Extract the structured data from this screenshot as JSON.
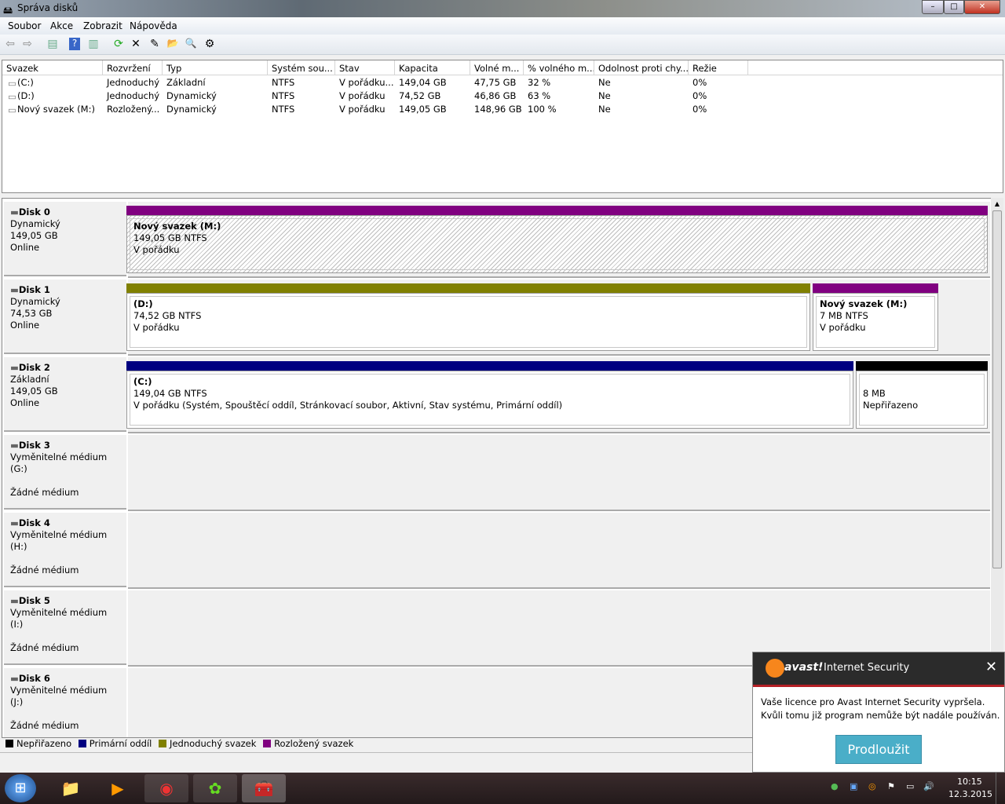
{
  "window": {
    "title": "Správa disků",
    "minimize": "–",
    "maximize": "□",
    "close": "✕"
  },
  "menu": [
    "Soubor",
    "Akce",
    "Zobrazit",
    "Nápověda"
  ],
  "toolbar": [
    {
      "icon": "back-icon",
      "glyph": "⇦"
    },
    {
      "icon": "forward-icon",
      "glyph": "⇨"
    },
    {
      "icon": "show-hide-console-tree-icon",
      "glyph": "▤"
    },
    {
      "icon": "help-icon",
      "glyph": "?"
    },
    {
      "icon": "show-action-pane-icon",
      "glyph": "▥"
    },
    {
      "icon": "refresh-icon",
      "glyph": "⟳"
    },
    {
      "icon": "delete-icon",
      "glyph": "✕"
    },
    {
      "icon": "properties-icon",
      "glyph": "✎"
    },
    {
      "icon": "open-folder-icon",
      "glyph": "📂"
    },
    {
      "icon": "explore-icon",
      "glyph": "🔍"
    },
    {
      "icon": "settings-icon",
      "glyph": "⚙"
    }
  ],
  "volumes": {
    "columns": [
      "Svazek",
      "Rozvržení",
      "Typ",
      "Systém sou...",
      "Stav",
      "Kapacita",
      "Volné m...",
      "% volného m...",
      "Odolnost proti chy...",
      "Režie"
    ],
    "rows": [
      [
        "(C:)",
        "Jednoduchý",
        "Základní",
        "NTFS",
        "V pořádku...",
        "149,04 GB",
        "47,75 GB",
        "32 %",
        "Ne",
        "0%"
      ],
      [
        "(D:)",
        "Jednoduchý",
        "Dynamický",
        "NTFS",
        "V pořádku",
        "74,52 GB",
        "46,86 GB",
        "63 %",
        "Ne",
        "0%"
      ],
      [
        "Nový svazek (M:)",
        "Rozložený...",
        "Dynamický",
        "NTFS",
        "V pořádku",
        "149,05 GB",
        "148,96 GB",
        "100 %",
        "Ne",
        "0%"
      ]
    ]
  },
  "disks": [
    {
      "name": "Disk 0",
      "type": "Dynamický",
      "size": "149,05 GB",
      "status": "Online"
    },
    {
      "name": "Disk 1",
      "type": "Dynamický",
      "size": "74,53 GB",
      "status": "Online"
    },
    {
      "name": "Disk 2",
      "type": "Základní",
      "size": "149,05 GB",
      "status": "Online"
    },
    {
      "name": "Disk 3",
      "type": "Vyměnitelné médium (G:)",
      "size": "",
      "status": "Žádné médium"
    },
    {
      "name": "Disk 4",
      "type": "Vyměnitelné médium (H:)",
      "size": "",
      "status": "Žádné médium"
    },
    {
      "name": "Disk 5",
      "type": "Vyměnitelné médium (I:)",
      "size": "",
      "status": "Žádné médium"
    },
    {
      "name": "Disk 6",
      "type": "Vyměnitelné médium (J:)",
      "size": "",
      "status": "Žádné médium"
    }
  ],
  "partitions": {
    "d0m": {
      "title": "Nový svazek  (M:)",
      "size": "149,05 GB NTFS",
      "status": "V pořádku"
    },
    "d1d": {
      "title": "(D:)",
      "size": "74,52 GB NTFS",
      "status": "V pořádku"
    },
    "d1m": {
      "title": "Nový svazek  (M:)",
      "size": "7 MB NTFS",
      "status": "V pořádku"
    },
    "d2c": {
      "title": "(C:)",
      "size": "149,04 GB NTFS",
      "status": "V pořádku (Systém, Spouštěcí oddíl, Stránkovací soubor, Aktivní, Stav systému, Primární oddíl)"
    },
    "d2u": {
      "size": "8 MB",
      "status": "Nepřiřazeno"
    }
  },
  "colors": {
    "unallocated": "#000000",
    "primary": "#000080",
    "simple": "#808000",
    "spanned": "#800080"
  },
  "legend": [
    "Nepřiřazeno",
    "Primární oddíl",
    "Jednoduchý svazek",
    "Rozložený svazek"
  ],
  "avast": {
    "brand": "avast!",
    "product": "Internet Security",
    "line1": "Vaše licence pro Avast Internet Security vypršela.",
    "line2": "Kvůli tomu již program nemůže být nadále používán.",
    "button": "Prodloužit",
    "close": "✕"
  },
  "taskbar": {
    "start": "⊞",
    "apps": [
      {
        "name": "explorer",
        "glyph": "📁"
      },
      {
        "name": "media-player",
        "glyph": "▶"
      },
      {
        "name": "chrome",
        "glyph": "◉"
      },
      {
        "name": "icq",
        "glyph": "✿"
      },
      {
        "name": "disk-management",
        "glyph": "🧰"
      }
    ],
    "tray": [
      "●",
      "▣",
      "◎",
      "⚑",
      "▭",
      "🔊"
    ],
    "time": "10:15",
    "date": "12.3.2015"
  }
}
